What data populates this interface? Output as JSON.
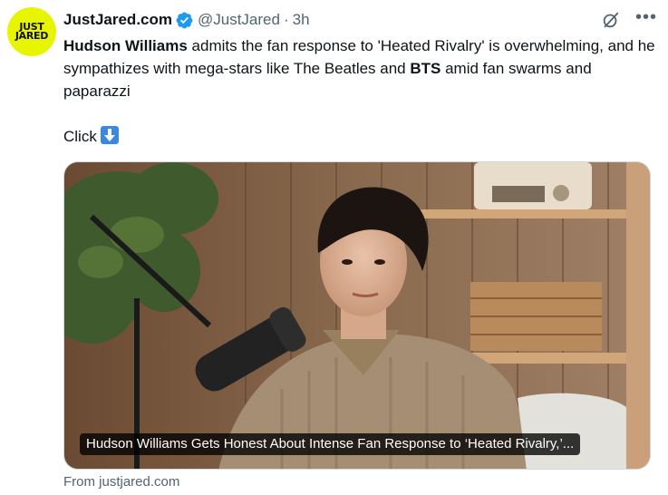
{
  "account": {
    "avatar_line1": "JUST",
    "avatar_line2": "JARED",
    "display_name": "JustJared.com",
    "handle": "@JustJared",
    "separator": "·",
    "time": "3h"
  },
  "tweet": {
    "bold1": "Hudson Williams",
    "text1": " admits the fan response to 'Heated Rivalry' is overwhelming, and he sympathizes with mega-stars like The Beatles and ",
    "bold2": "BTS",
    "text2": " amid fan swarms and paparazzi",
    "cta": "Click"
  },
  "card": {
    "caption": "Hudson Williams Gets Honest About Intense Fan Response to ‘Heated Rivalry,’...",
    "source": "From justjared.com"
  },
  "icons": {
    "verified": "verified-badge-icon",
    "grok": "grok-icon",
    "more": "more-options-icon",
    "arrow": "down-arrow-emoji-icon"
  },
  "colors": {
    "accent": "#1d9bf0",
    "avatar_bg": "#e8f500",
    "secondary_text": "#536471"
  }
}
